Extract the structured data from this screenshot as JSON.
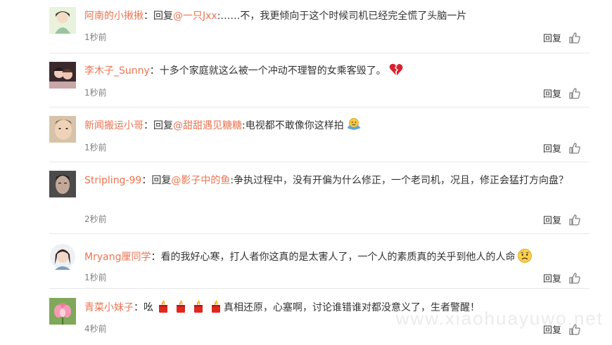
{
  "comments": [
    {
      "user": "阿南的小揪揪",
      "reply_prefix": "回复",
      "mention": "@一只Jxx",
      "text": ":……不，我更倾向于这个时候司机已经完全慌了头脑一片",
      "time": "1秒前",
      "reply_label": "回复",
      "emojis": []
    },
    {
      "user": "李木子_Sunny",
      "reply_prefix": "",
      "mention": "",
      "text": "十多个家庭就这么被一个冲动不理智的女乘客毁了。",
      "time": "1秒前",
      "reply_label": "回复",
      "emojis": [
        "broken-heart-emoji"
      ]
    },
    {
      "user": "新闻搬运小哥",
      "reply_prefix": "回复",
      "mention": "@甜甜遇见糖糖",
      "text": ":电视都不敢像你这样拍",
      "time": "1秒前",
      "reply_label": "回复",
      "emojis": [
        "shrug-emoji"
      ]
    },
    {
      "user": "Stripling-99",
      "reply_prefix": "回复",
      "mention": "@影子中的鱼",
      "text": ":争执过程中，没有开偏为什么修正，一个老司机，况且，修正会猛打方向盘？",
      "time": "2秒前",
      "reply_label": "回复",
      "emojis": []
    },
    {
      "user": "Mryang厘同学",
      "reply_prefix": "",
      "mention": "",
      "text": "看的我好心寒，打人者你这真的是太害人了，一个人的素质真的关乎到他人的人命",
      "time": "1秒前",
      "reply_label": "回复",
      "emojis": [
        "sad-face-emoji"
      ]
    },
    {
      "user": "青菜小妹子",
      "reply_prefix": "",
      "mention": "",
      "text_before": "吆",
      "text": "真相还原，心塞啊，讨论谁错谁对都没意义了，生者警醒！",
      "time": "4秒前",
      "reply_label": "回复",
      "emojis": [
        "candle-emoji",
        "candle-emoji",
        "candle-emoji",
        "candle-emoji"
      ]
    }
  ],
  "separator": "：",
  "colors": {
    "username": "#eb7350",
    "text": "#333333",
    "time": "#808080",
    "divider": "#e8e8e8"
  },
  "watermark": "www.xiaohuayuwo.net"
}
